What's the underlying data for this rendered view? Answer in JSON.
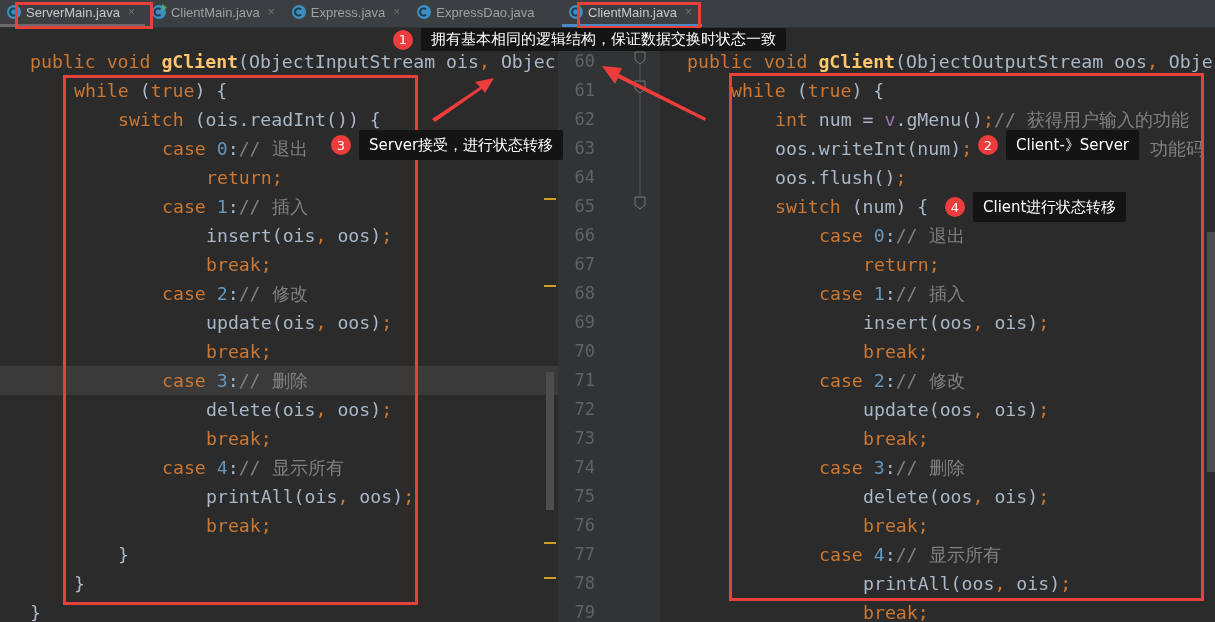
{
  "left_tabs": [
    {
      "label": "ServerMain.java",
      "kind": "class",
      "close": "×",
      "selected": true
    },
    {
      "label": "ClientMain.java",
      "kind": "runnable",
      "close": "×",
      "selected": false
    },
    {
      "label": "Express.java",
      "kind": "class",
      "close": "×",
      "selected": false
    },
    {
      "label": "ExpressDao.java",
      "kind": "class",
      "selected": false
    }
  ],
  "right_tabs": [
    {
      "label": "ClientMain.java",
      "kind": "class",
      "close": "×",
      "selected": true
    }
  ],
  "left_editor": {
    "lines": [
      {
        "current": false,
        "tokens": [
          {
            "t": "public void ",
            "kind": "kw"
          },
          {
            "t": "gClient",
            "kind": "fn"
          },
          {
            "t": "(ObjectInputStream ois",
            "kind": "plain"
          },
          {
            "t": ", ",
            "kind": "kw"
          },
          {
            "t": "Objec",
            "kind": "plain"
          }
        ]
      },
      {
        "current": false,
        "tokens": [
          {
            "t": "    while ",
            "kind": "kw"
          },
          {
            "t": "(",
            "kind": "plain"
          },
          {
            "t": "true",
            "kind": "kw"
          },
          {
            "t": ") {",
            "kind": "plain"
          }
        ]
      },
      {
        "current": false,
        "tokens": [
          {
            "t": "        switch ",
            "kind": "kw"
          },
          {
            "t": "(ois.readInt()) {",
            "kind": "plain"
          }
        ]
      },
      {
        "current": false,
        "tokens": [
          {
            "t": "            case ",
            "kind": "kw"
          },
          {
            "t": "0",
            "kind": "num"
          },
          {
            "t": ":",
            "kind": "plain"
          },
          {
            "t": "// 退出",
            "kind": "com"
          }
        ]
      },
      {
        "current": false,
        "tokens": [
          {
            "t": "                return;",
            "kind": "kw"
          }
        ]
      },
      {
        "current": false,
        "tokens": [
          {
            "t": "            case ",
            "kind": "kw"
          },
          {
            "t": "1",
            "kind": "num"
          },
          {
            "t": ":",
            "kind": "plain"
          },
          {
            "t": "// 插入",
            "kind": "com"
          }
        ]
      },
      {
        "current": false,
        "tokens": [
          {
            "t": "                insert(ois",
            "kind": "plain"
          },
          {
            "t": ", ",
            "kind": "kw"
          },
          {
            "t": "oos)",
            "kind": "plain"
          },
          {
            "t": ";",
            "kind": "kw"
          }
        ]
      },
      {
        "current": false,
        "tokens": [
          {
            "t": "                break;",
            "kind": "kw"
          }
        ]
      },
      {
        "current": false,
        "tokens": [
          {
            "t": "            case ",
            "kind": "kw"
          },
          {
            "t": "2",
            "kind": "num"
          },
          {
            "t": ":",
            "kind": "plain"
          },
          {
            "t": "// 修改",
            "kind": "com"
          }
        ]
      },
      {
        "current": false,
        "tokens": [
          {
            "t": "                update(ois",
            "kind": "plain"
          },
          {
            "t": ", ",
            "kind": "kw"
          },
          {
            "t": "oos)",
            "kind": "plain"
          },
          {
            "t": ";",
            "kind": "kw"
          }
        ]
      },
      {
        "current": false,
        "tokens": [
          {
            "t": "                break;",
            "kind": "kw"
          }
        ]
      },
      {
        "current": true,
        "tokens": [
          {
            "t": "            case ",
            "kind": "kw"
          },
          {
            "t": "3",
            "kind": "num"
          },
          {
            "t": ":",
            "kind": "plain"
          },
          {
            "t": "// 删除",
            "kind": "com"
          }
        ]
      },
      {
        "current": false,
        "tokens": [
          {
            "t": "                delete(ois",
            "kind": "plain"
          },
          {
            "t": ", ",
            "kind": "kw"
          },
          {
            "t": "oos)",
            "kind": "plain"
          },
          {
            "t": ";",
            "kind": "kw"
          }
        ]
      },
      {
        "current": false,
        "tokens": [
          {
            "t": "                break;",
            "kind": "kw"
          }
        ]
      },
      {
        "current": false,
        "tokens": [
          {
            "t": "            case ",
            "kind": "kw"
          },
          {
            "t": "4",
            "kind": "num"
          },
          {
            "t": ":",
            "kind": "plain"
          },
          {
            "t": "// 显示所有",
            "kind": "com"
          }
        ]
      },
      {
        "current": false,
        "tokens": [
          {
            "t": "                printAll(ois",
            "kind": "plain"
          },
          {
            "t": ", ",
            "kind": "kw"
          },
          {
            "t": "oos)",
            "kind": "plain"
          },
          {
            "t": ";",
            "kind": "kw"
          }
        ]
      },
      {
        "current": false,
        "tokens": [
          {
            "t": "                break;",
            "kind": "kw"
          }
        ]
      },
      {
        "current": false,
        "tokens": [
          {
            "t": "        }",
            "kind": "plain"
          }
        ]
      },
      {
        "current": false,
        "tokens": [
          {
            "t": "    }",
            "kind": "plain"
          }
        ]
      },
      {
        "current": false,
        "tokens": [
          {
            "t": "}",
            "kind": "plain"
          }
        ]
      }
    ]
  },
  "right_editor": {
    "lines": [
      {
        "number": "60",
        "tokens": [
          {
            "t": "public void ",
            "kind": "kw"
          },
          {
            "t": "gClient",
            "kind": "fn"
          },
          {
            "t": "(ObjectOutputStream oos",
            "kind": "plain"
          },
          {
            "t": ", ",
            "kind": "kw"
          },
          {
            "t": "Obje",
            "kind": "plain"
          }
        ]
      },
      {
        "number": "61",
        "tokens": [
          {
            "t": "    while ",
            "kind": "kw"
          },
          {
            "t": "(",
            "kind": "plain"
          },
          {
            "t": "true",
            "kind": "kw"
          },
          {
            "t": ") {",
            "kind": "plain"
          }
        ]
      },
      {
        "number": "62",
        "tokens": [
          {
            "t": "        int ",
            "kind": "kw"
          },
          {
            "t": "num = ",
            "kind": "plain"
          },
          {
            "t": "v",
            "kind": "field"
          },
          {
            "t": ".gMenu()",
            "kind": "plain"
          },
          {
            "t": ";",
            "kind": "kw"
          },
          {
            "t": "// 获得用户输入的功能",
            "kind": "com"
          }
        ]
      },
      {
        "number": "63",
        "tokens": [
          {
            "t": "        oos.writeInt(num)",
            "kind": "plain"
          },
          {
            "t": ";",
            "kind": "kw"
          },
          {
            "t": "功能码",
            "kind": "com_past_callout"
          }
        ]
      },
      {
        "number": "64",
        "tokens": [
          {
            "t": "        oos.flush()",
            "kind": "plain"
          },
          {
            "t": ";",
            "kind": "kw"
          }
        ]
      },
      {
        "number": "65",
        "tokens": [
          {
            "t": "        switch ",
            "kind": "kw"
          },
          {
            "t": "(num) {",
            "kind": "plain"
          }
        ]
      },
      {
        "number": "66",
        "tokens": [
          {
            "t": "            case ",
            "kind": "kw"
          },
          {
            "t": "0",
            "kind": "num"
          },
          {
            "t": ":",
            "kind": "plain"
          },
          {
            "t": "// 退出",
            "kind": "com"
          }
        ]
      },
      {
        "number": "67",
        "tokens": [
          {
            "t": "                return;",
            "kind": "kw"
          }
        ]
      },
      {
        "number": "68",
        "tokens": [
          {
            "t": "            case ",
            "kind": "kw"
          },
          {
            "t": "1",
            "kind": "num"
          },
          {
            "t": ":",
            "kind": "plain"
          },
          {
            "t": "// 插入",
            "kind": "com"
          }
        ]
      },
      {
        "number": "69",
        "tokens": [
          {
            "t": "                insert(oos",
            "kind": "plain"
          },
          {
            "t": ", ",
            "kind": "kw"
          },
          {
            "t": "ois)",
            "kind": "plain"
          },
          {
            "t": ";",
            "kind": "kw"
          }
        ]
      },
      {
        "number": "70",
        "tokens": [
          {
            "t": "                break;",
            "kind": "kw"
          }
        ]
      },
      {
        "number": "71",
        "tokens": [
          {
            "t": "            case ",
            "kind": "kw"
          },
          {
            "t": "2",
            "kind": "num"
          },
          {
            "t": ":",
            "kind": "plain"
          },
          {
            "t": "// 修改",
            "kind": "com"
          }
        ]
      },
      {
        "number": "72",
        "tokens": [
          {
            "t": "                update(oos",
            "kind": "plain"
          },
          {
            "t": ", ",
            "kind": "kw"
          },
          {
            "t": "ois)",
            "kind": "plain"
          },
          {
            "t": ";",
            "kind": "kw"
          }
        ]
      },
      {
        "number": "73",
        "tokens": [
          {
            "t": "                break;",
            "kind": "kw"
          }
        ]
      },
      {
        "number": "74",
        "tokens": [
          {
            "t": "            case ",
            "kind": "kw"
          },
          {
            "t": "3",
            "kind": "num"
          },
          {
            "t": ":",
            "kind": "plain"
          },
          {
            "t": "// 删除",
            "kind": "com"
          }
        ]
      },
      {
        "number": "75",
        "tokens": [
          {
            "t": "                delete(oos",
            "kind": "plain"
          },
          {
            "t": ", ",
            "kind": "kw"
          },
          {
            "t": "ois)",
            "kind": "plain"
          },
          {
            "t": ";",
            "kind": "kw"
          }
        ]
      },
      {
        "number": "76",
        "tokens": [
          {
            "t": "                break;",
            "kind": "kw"
          }
        ]
      },
      {
        "number": "77",
        "tokens": [
          {
            "t": "            case ",
            "kind": "kw"
          },
          {
            "t": "4",
            "kind": "num"
          },
          {
            "t": ":",
            "kind": "plain"
          },
          {
            "t": "// 显示所有",
            "kind": "com"
          }
        ]
      },
      {
        "number": "78",
        "tokens": [
          {
            "t": "                printAll(oos",
            "kind": "plain"
          },
          {
            "t": ", ",
            "kind": "kw"
          },
          {
            "t": "ois)",
            "kind": "plain"
          },
          {
            "t": ";",
            "kind": "kw"
          }
        ]
      },
      {
        "number": "79",
        "tokens": [
          {
            "t": "                break;",
            "kind": "kw"
          }
        ]
      }
    ]
  },
  "callouts": [
    {
      "badge": "1",
      "text": "拥有基本相同的逻辑结构，保证数据交换时状态一致",
      "kind": "top"
    },
    {
      "badge": "3",
      "text": "Server接受，进行状态转移",
      "kind": "left"
    },
    {
      "badge": "2",
      "text": "Client-》Server",
      "kind": "right_upper"
    },
    {
      "badge": "4",
      "text": "Client进行状态转移",
      "kind": "right_lower"
    }
  ]
}
